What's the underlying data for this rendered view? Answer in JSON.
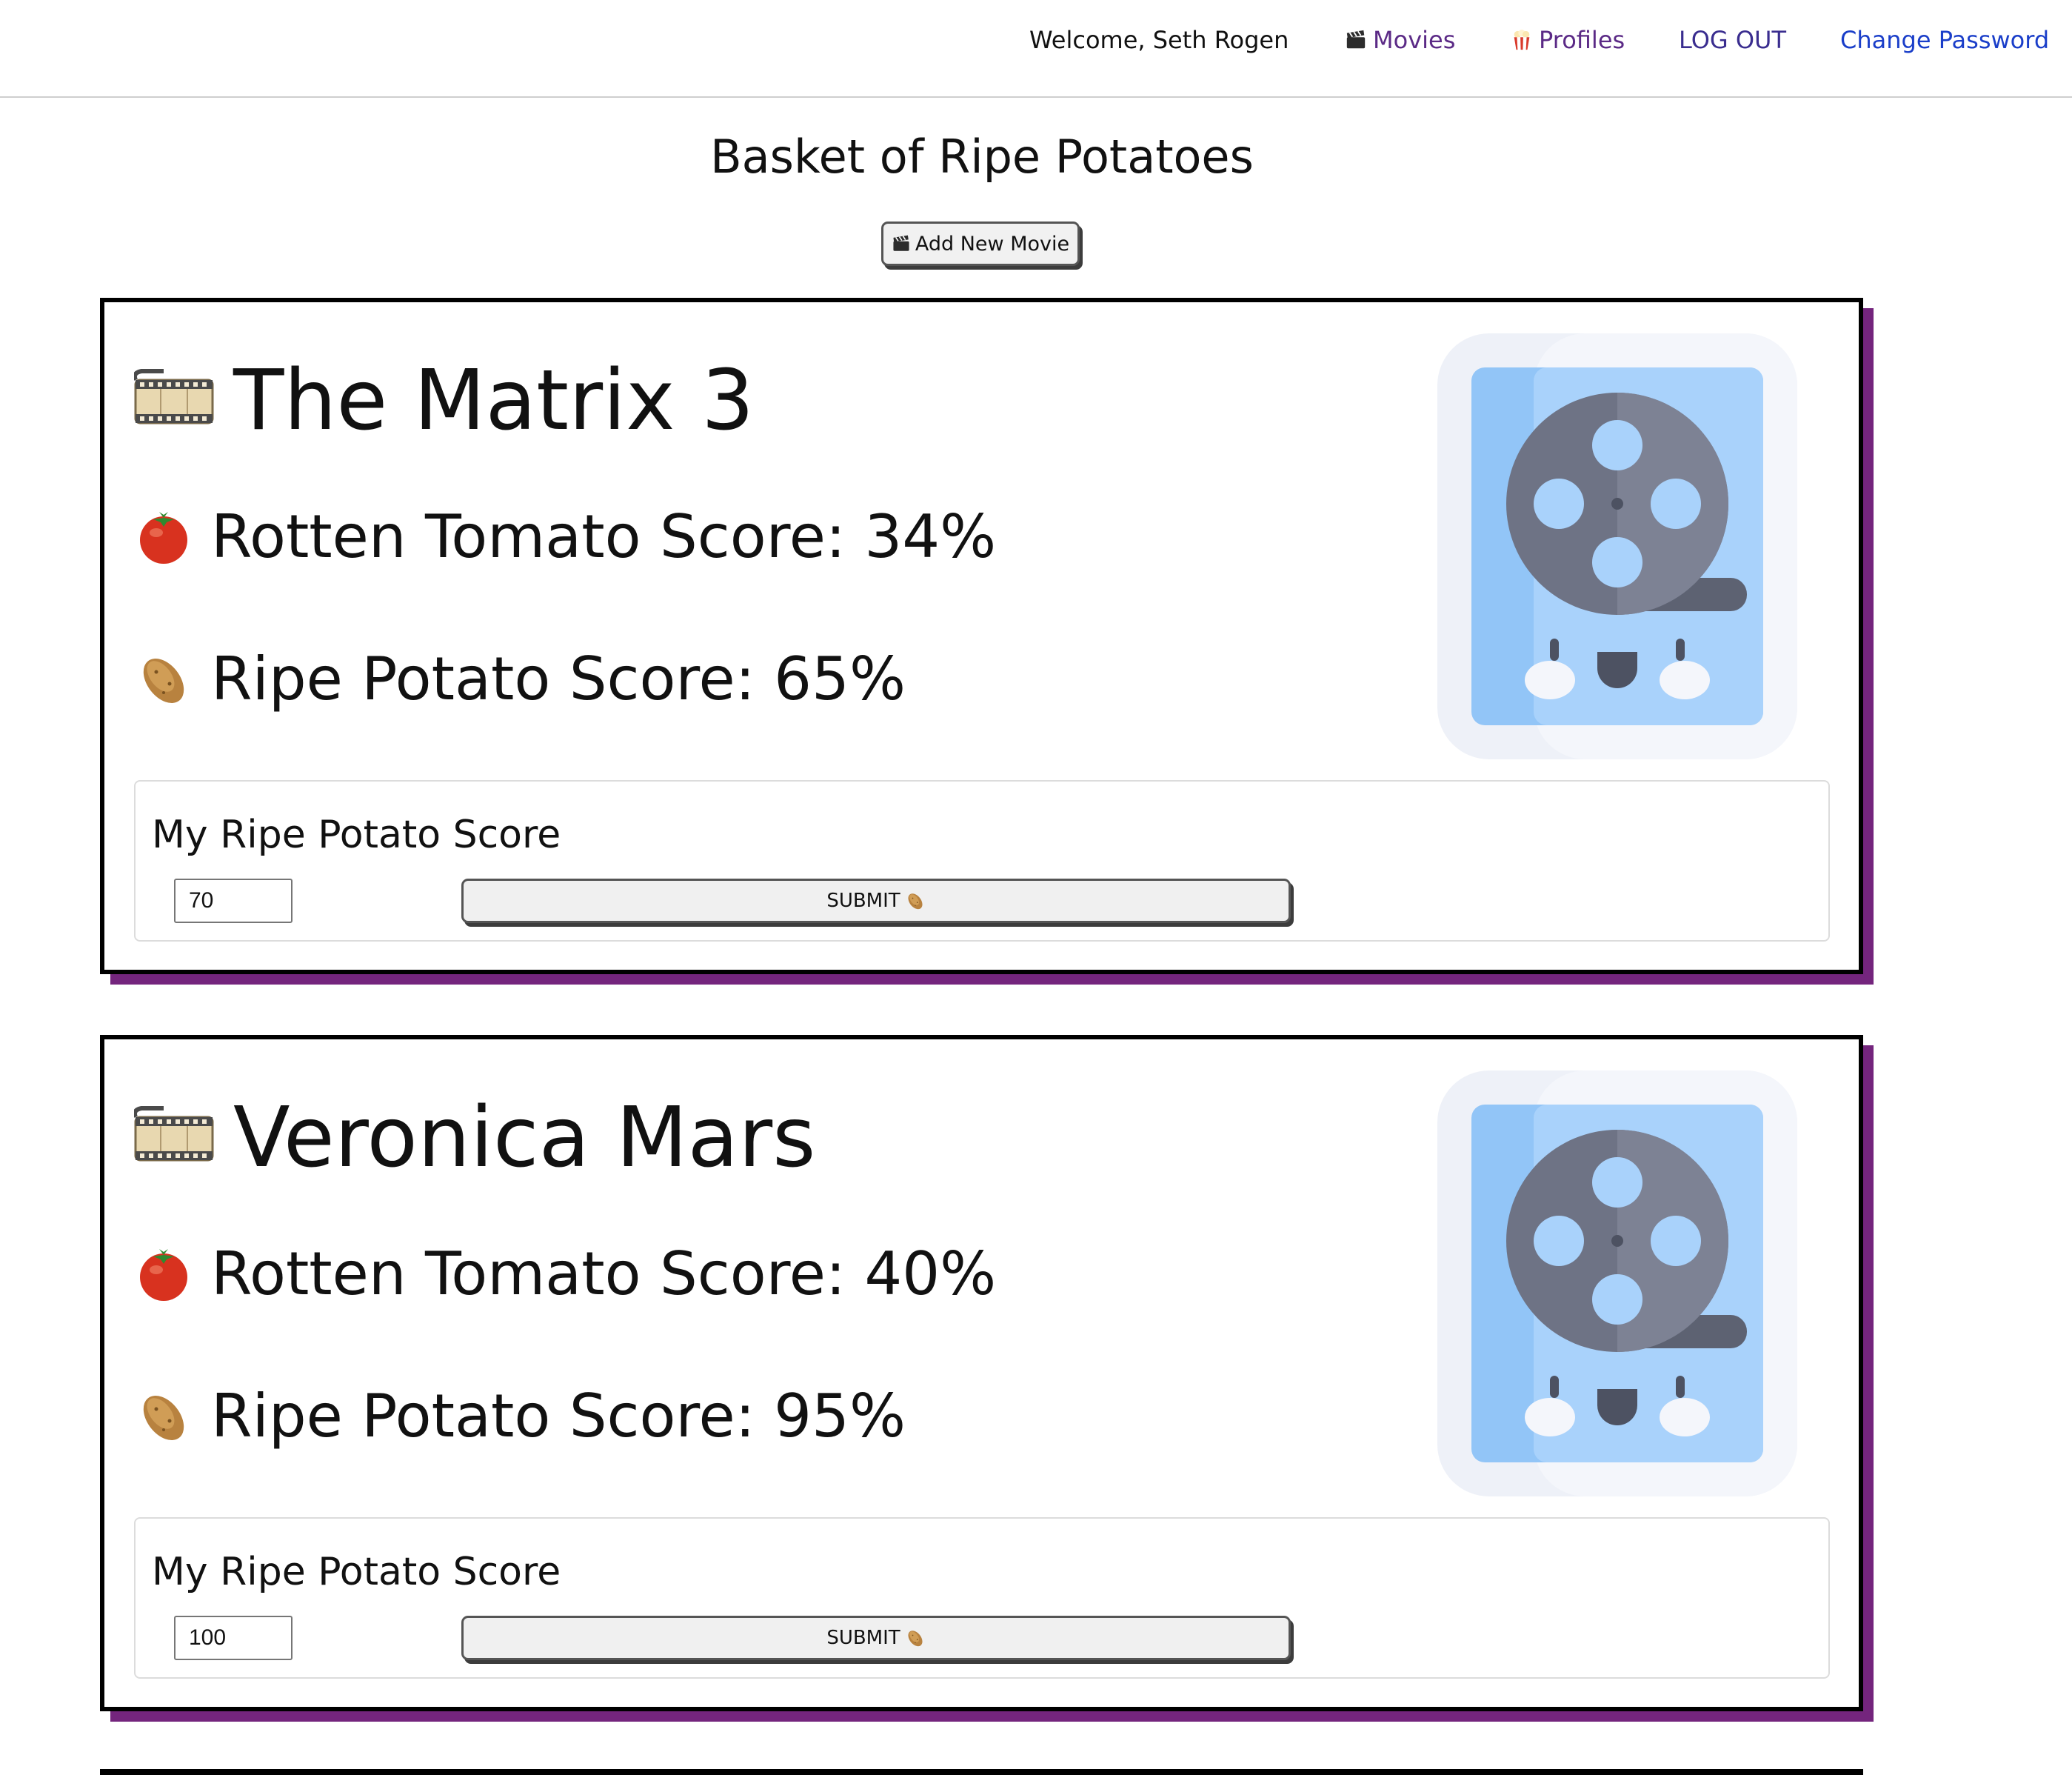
{
  "nav": {
    "welcome": "Welcome, Seth Rogen",
    "movies": "Movies",
    "movies_icon": "clapper-board-icon",
    "profiles": "Profiles",
    "profiles_icon": "popcorn-icon",
    "logout": "LOG OUT",
    "change_password": "Change Password"
  },
  "page": {
    "title": "Basket of Ripe Potatoes",
    "add_button": "Add New Movie",
    "add_button_icon": "clapper-board-icon"
  },
  "movies": [
    {
      "title": "The Matrix 3",
      "rt_score_text": "Rotten Tomato Score: 34%",
      "rp_score_text": "Ripe Potato Score: 65%",
      "rating_label": "My Ripe Potato Score",
      "rating_value": "70",
      "submit_label": "SUBMIT"
    },
    {
      "title": "Veronica Mars",
      "rt_score_text": "Rotten Tomato Score: 40%",
      "rp_score_text": "Ripe Potato Score: 95%",
      "rating_label": "My Ripe Potato Score",
      "rating_value": "100",
      "submit_label": "SUBMIT"
    }
  ],
  "colors": {
    "card_shadow": "#74257d",
    "nav_link": "#5b2a86",
    "nav_change_password": "#1a3ec9"
  }
}
